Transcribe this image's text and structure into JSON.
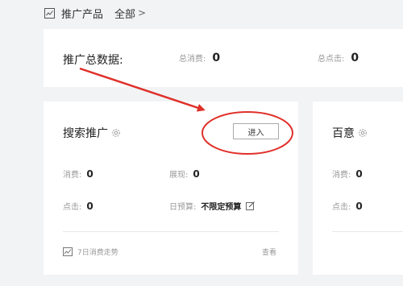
{
  "header": {
    "title": "推广产品",
    "all_label": "全部",
    "chevron": ">"
  },
  "summary": {
    "label": "推广总数据:",
    "cost_label": "总消费:",
    "cost_value": "0",
    "clicks_label": "总点击:",
    "clicks_value": "0"
  },
  "search_card": {
    "title": "搜索推广",
    "enter_label": "进入",
    "cost_label": "消费:",
    "cost_value": "0",
    "impressions_label": "展现:",
    "impressions_value": "0",
    "clicks_label": "点击:",
    "clicks_value": "0",
    "budget_label": "日预算:",
    "budget_value": "不限定预算",
    "trend_label": "7日消费走势",
    "view_label": "查看"
  },
  "baiyi_card": {
    "title": "百意",
    "cost_label": "消费:",
    "cost_value": "0",
    "clicks_label": "点击:",
    "clicks_value": "0"
  },
  "annotation_color": "#e0302a"
}
